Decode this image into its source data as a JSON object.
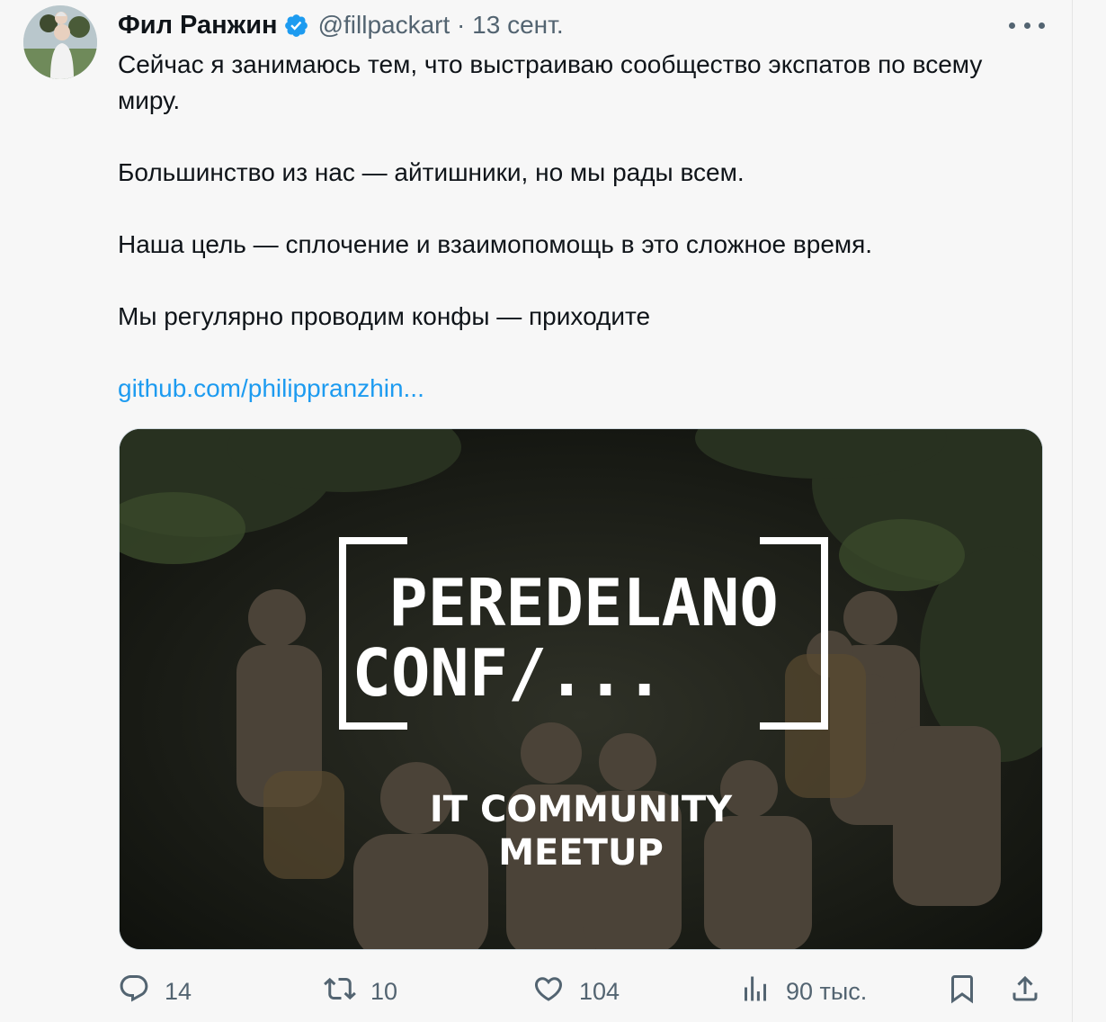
{
  "tweet": {
    "author_name": "Фил Ранжин",
    "handle_date": "@fillpackart · 13 сент.",
    "paragraphs": [
      "Сейчас я занимаюсь тем, что выстраиваю сообщество экспатов по всему миру.",
      "Большинство из нас — айтишники, но мы рады всем.",
      "Наша цель — сплочение и взаимопомощь в это сложное время.",
      "Мы регулярно проводим конфы — приходите"
    ],
    "link": "github.com/philippranzhin..."
  },
  "media": {
    "title_line1": "PEREDELANO",
    "title_line2": "CONF/...",
    "subtitle_line1": "IT COMMUNITY",
    "subtitle_line2": "MEETUP"
  },
  "actions": {
    "replies": "14",
    "retweets": "10",
    "likes": "104",
    "views": "90 тыс."
  },
  "icons": {
    "verified": "verified-badge-icon",
    "more": "more-icon",
    "reply": "reply-icon",
    "retweet": "retweet-icon",
    "like": "heart-icon",
    "views": "views-icon",
    "bookmark": "bookmark-icon",
    "share": "share-icon"
  },
  "colors": {
    "link": "#1d9bf0",
    "verified": "#1d9bf0",
    "secondary_text": "#536471"
  }
}
